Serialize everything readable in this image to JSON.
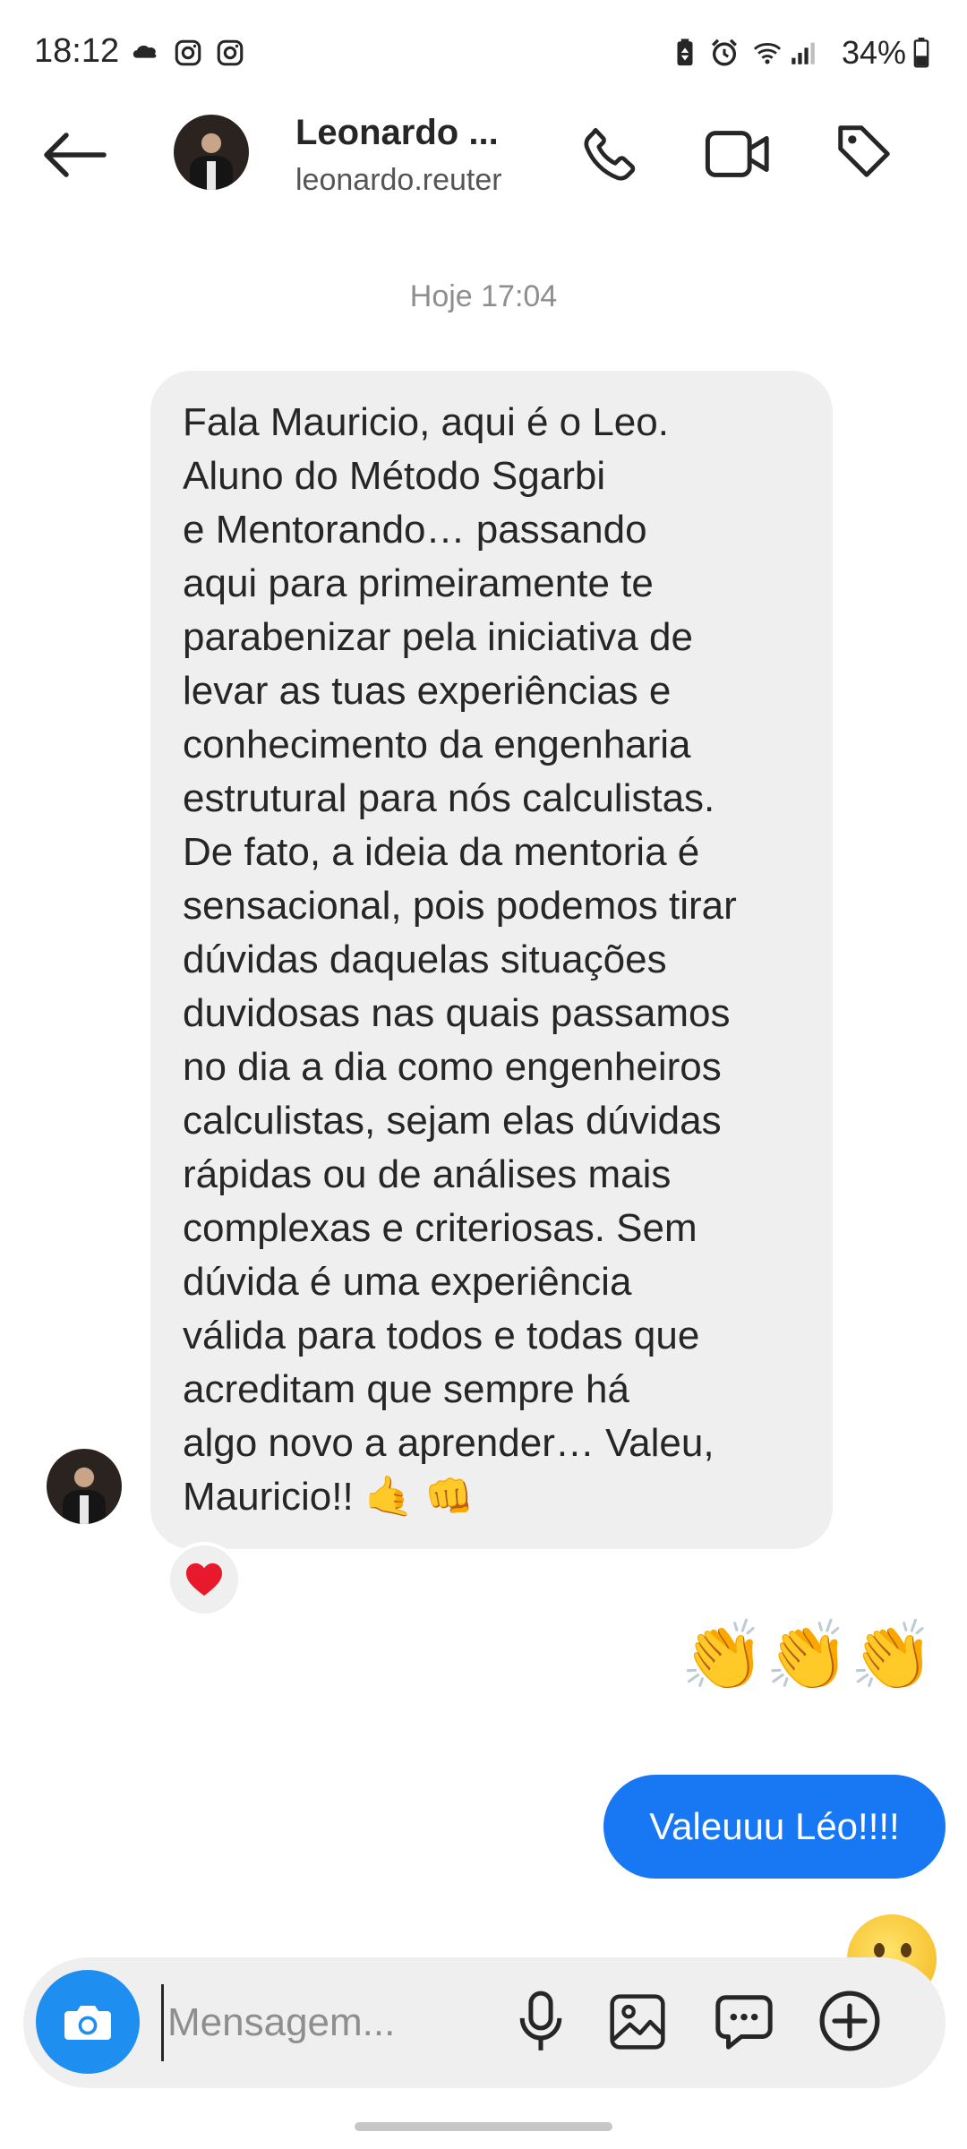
{
  "status_bar": {
    "time": "18:12",
    "battery": "34%",
    "icons": [
      "cloud-icon",
      "instagram-icon",
      "instagram-icon",
      "battery-saver-icon",
      "alarm-icon",
      "wifi-icon",
      "signal-icon",
      "battery-icon"
    ]
  },
  "header": {
    "name": "Leonardo ...",
    "username": "leonardo.reuter",
    "icons": [
      "back-arrow-icon",
      "phone-icon",
      "video-icon",
      "tag-icon"
    ]
  },
  "conversation": {
    "date_label": "Hoje 17:04",
    "incoming_lines": [
      "Fala Mauricio, aqui é o Leo.",
      "Aluno do Método Sgarbi",
      "e Mentorando… passando",
      "aqui para primeiramente te",
      "parabenizar pela iniciativa de",
      "levar as tuas experiências e",
      "conhecimento da engenharia",
      "estrutural para nós calculistas.",
      "De fato, a ideia da mentoria é",
      "sensacional, pois podemos tirar",
      "dúvidas daquelas situações",
      "duvidosas nas quais passamos",
      "no dia a dia como engenheiros",
      "calculistas, sejam elas dúvidas",
      "rápidas ou de análises mais",
      "complexas e criteriosas. Sem",
      "dúvida é uma experiência",
      "válida para todos e todas que",
      "acreditam que sempre há",
      "algo novo a aprender… Valeu,",
      "Mauricio!! 🤙 👊"
    ],
    "reaction": "❤️",
    "outgoing_emoji": "👏👏👏",
    "outgoing_text": "Valeuuu Léo!!!!"
  },
  "composer": {
    "placeholder": "Mensagem...",
    "icons": [
      "camera-icon",
      "microphone-icon",
      "gallery-icon",
      "sticker-icon",
      "add-icon"
    ]
  },
  "colors": {
    "outgoing_bubble": "#1878f3",
    "camera_button": "#1e8ff0",
    "incoming_bubble": "#efefef"
  }
}
